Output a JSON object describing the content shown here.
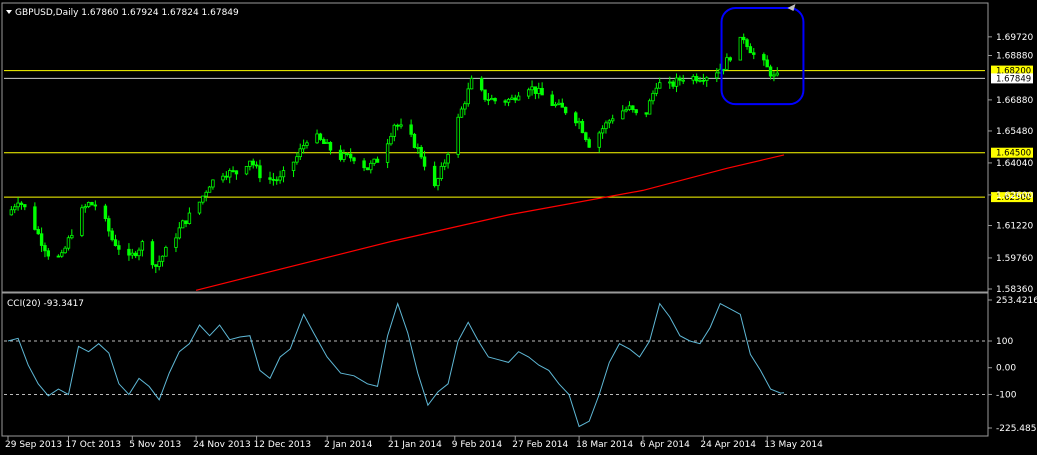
{
  "chart_data": [
    {
      "type": "candlestick",
      "title": "GBPUSD,Daily  1.67860 1.67924 1.67824 1.67849",
      "symbol": "GBPUSD",
      "timeframe": "Daily",
      "ohlc_readout": {
        "open": "1.67860",
        "high": "1.67924",
        "low": "1.67824",
        "close": "1.67849"
      },
      "ylim": [
        1.5836,
        1.712
      ],
      "y_ticks": [
        "1.69720",
        "1.68880",
        "1.66880",
        "1.65480",
        "1.64040",
        "1.62600",
        "1.61220",
        "1.59760",
        "1.58360"
      ],
      "x_ticks": [
        "29 Sep 2013",
        "17 Oct 2013",
        "5 Nov 2013",
        "24 Nov 2013",
        "12 Dec 2013",
        "2 Jan 2014",
        "21 Jan 2014",
        "9 Feb 2014",
        "27 Feb 2014",
        "18 Mar 2014",
        "6 Apr 2014",
        "24 Apr 2014",
        "13 May 2014"
      ],
      "x_start": "2013-09-29",
      "x_end": "2014-05-18",
      "candle_color": "#00ff00",
      "horizontal_levels": [
        {
          "value": 1.682,
          "label": "1.68200",
          "color": "#ffff00"
        },
        {
          "value": 1.645,
          "label": "1.64500",
          "color": "#ffff00"
        },
        {
          "value": 1.625,
          "label": "1.62500",
          "color": "#ffff00"
        }
      ],
      "current_price": {
        "value": 1.67849,
        "label": "1.67849",
        "color": "#ffffff"
      },
      "moving_average": {
        "color": "#ff0000",
        "points": [
          {
            "x": "2013-11-24",
            "y": 1.583
          },
          {
            "x": "2014-01-21",
            "y": 1.605
          },
          {
            "x": "2014-02-25",
            "y": 1.617
          },
          {
            "x": "2014-04-06",
            "y": 1.628
          },
          {
            "x": "2014-05-01",
            "y": 1.638
          },
          {
            "x": "2014-05-18",
            "y": 1.644
          }
        ]
      },
      "close_path": [
        {
          "x": "2013-09-29",
          "y": 1.617
        },
        {
          "x": "2013-10-02",
          "y": 1.624
        },
        {
          "x": "2013-10-05",
          "y": 1.618
        },
        {
          "x": "2013-10-09",
          "y": 1.605
        },
        {
          "x": "2013-10-12",
          "y": 1.597
        },
        {
          "x": "2013-10-15",
          "y": 1.598
        },
        {
          "x": "2013-10-20",
          "y": 1.617
        },
        {
          "x": "2013-10-23",
          "y": 1.622
        },
        {
          "x": "2013-10-26",
          "y": 1.621
        },
        {
          "x": "2013-10-30",
          "y": 1.606
        },
        {
          "x": "2013-11-04",
          "y": 1.597
        },
        {
          "x": "2013-11-08",
          "y": 1.604
        },
        {
          "x": "2013-11-12",
          "y": 1.594
        },
        {
          "x": "2013-11-16",
          "y": 1.603
        },
        {
          "x": "2013-11-20",
          "y": 1.613
        },
        {
          "x": "2013-11-24",
          "y": 1.62
        },
        {
          "x": "2013-11-28",
          "y": 1.631
        },
        {
          "x": "2013-12-02",
          "y": 1.636
        },
        {
          "x": "2013-12-06",
          "y": 1.636
        },
        {
          "x": "2013-12-10",
          "y": 1.642
        },
        {
          "x": "2013-12-14",
          "y": 1.633
        },
        {
          "x": "2013-12-19",
          "y": 1.633
        },
        {
          "x": "2013-12-24",
          "y": 1.643
        },
        {
          "x": "2013-12-28",
          "y": 1.654
        },
        {
          "x": "2014-01-01",
          "y": 1.649
        },
        {
          "x": "2014-01-06",
          "y": 1.643
        },
        {
          "x": "2014-01-10",
          "y": 1.643
        },
        {
          "x": "2014-01-14",
          "y": 1.638
        },
        {
          "x": "2014-01-18",
          "y": 1.643
        },
        {
          "x": "2014-01-22",
          "y": 1.658
        },
        {
          "x": "2014-01-26",
          "y": 1.654
        },
        {
          "x": "2014-01-30",
          "y": 1.644
        },
        {
          "x": "2014-02-03",
          "y": 1.629
        },
        {
          "x": "2014-02-06",
          "y": 1.641
        },
        {
          "x": "2014-02-10",
          "y": 1.66
        },
        {
          "x": "2014-02-14",
          "y": 1.677
        },
        {
          "x": "2014-02-18",
          "y": 1.67
        },
        {
          "x": "2014-02-22",
          "y": 1.668
        },
        {
          "x": "2014-02-26",
          "y": 1.669
        },
        {
          "x": "2014-03-02",
          "y": 1.676
        },
        {
          "x": "2014-03-06",
          "y": 1.672
        },
        {
          "x": "2014-03-10",
          "y": 1.667
        },
        {
          "x": "2014-03-14",
          "y": 1.664
        },
        {
          "x": "2014-03-18",
          "y": 1.659
        },
        {
          "x": "2014-03-21",
          "y": 1.649
        },
        {
          "x": "2014-03-25",
          "y": 1.656
        },
        {
          "x": "2014-03-29",
          "y": 1.663
        },
        {
          "x": "2014-04-02",
          "y": 1.665
        },
        {
          "x": "2014-04-06",
          "y": 1.659
        },
        {
          "x": "2014-04-10",
          "y": 1.676
        },
        {
          "x": "2014-04-14",
          "y": 1.675
        },
        {
          "x": "2014-04-18",
          "y": 1.679
        },
        {
          "x": "2014-04-22",
          "y": 1.679
        },
        {
          "x": "2014-04-26",
          "y": 1.68
        },
        {
          "x": "2014-04-30",
          "y": 1.684
        },
        {
          "x": "2014-05-03",
          "y": 1.691
        },
        {
          "x": "2014-05-06",
          "y": 1.697
        },
        {
          "x": "2014-05-09",
          "y": 1.689
        },
        {
          "x": "2014-05-12",
          "y": 1.685
        },
        {
          "x": "2014-05-15",
          "y": 1.679
        },
        {
          "x": "2014-05-18",
          "y": 1.679
        }
      ],
      "annotation": {
        "shape": "rounded-rectangle",
        "color": "#0000ff",
        "x_range": [
          "2014-04-30",
          "2014-05-22"
        ],
        "y_range": [
          1.675,
          1.712
        ]
      }
    },
    {
      "type": "line",
      "title": "CCI(20) -93.3417",
      "indicator": "CCI(20)",
      "current_value": "-93.3417",
      "ylim": [
        -225.4853,
        253.4216
      ],
      "y_ticks": [
        "253.4216",
        "100",
        "0.00",
        "-100",
        "-225.4853"
      ],
      "reference_lines": [
        100,
        -100
      ],
      "line_color": "#5fb8d6",
      "series": [
        {
          "values": [
            {
              "x": "2013-09-29",
              "y": 100
            },
            {
              "x": "2013-10-02",
              "y": 110
            },
            {
              "x": "2013-10-05",
              "y": 10
            },
            {
              "x": "2013-10-08",
              "y": -60
            },
            {
              "x": "2013-10-11",
              "y": -105
            },
            {
              "x": "2013-10-14",
              "y": -80
            },
            {
              "x": "2013-10-17",
              "y": -100
            },
            {
              "x": "2013-10-20",
              "y": 80
            },
            {
              "x": "2013-10-23",
              "y": 60
            },
            {
              "x": "2013-10-26",
              "y": 90
            },
            {
              "x": "2013-10-29",
              "y": 55
            },
            {
              "x": "2013-11-01",
              "y": -60
            },
            {
              "x": "2013-11-04",
              "y": -100
            },
            {
              "x": "2013-11-07",
              "y": -40
            },
            {
              "x": "2013-11-10",
              "y": -70
            },
            {
              "x": "2013-11-13",
              "y": -120
            },
            {
              "x": "2013-11-16",
              "y": -20
            },
            {
              "x": "2013-11-19",
              "y": 60
            },
            {
              "x": "2013-11-22",
              "y": 90
            },
            {
              "x": "2013-11-25",
              "y": 160
            },
            {
              "x": "2013-11-28",
              "y": 120
            },
            {
              "x": "2013-12-01",
              "y": 160
            },
            {
              "x": "2013-12-04",
              "y": 105
            },
            {
              "x": "2013-12-07",
              "y": 115
            },
            {
              "x": "2013-12-10",
              "y": 120
            },
            {
              "x": "2013-12-13",
              "y": -10
            },
            {
              "x": "2013-12-16",
              "y": -40
            },
            {
              "x": "2013-12-19",
              "y": 40
            },
            {
              "x": "2013-12-22",
              "y": 70
            },
            {
              "x": "2013-12-26",
              "y": 200
            },
            {
              "x": "2013-12-29",
              "y": 130
            },
            {
              "x": "2014-01-02",
              "y": 40
            },
            {
              "x": "2014-01-06",
              "y": -20
            },
            {
              "x": "2014-01-10",
              "y": -30
            },
            {
              "x": "2014-01-14",
              "y": -60
            },
            {
              "x": "2014-01-17",
              "y": -70
            },
            {
              "x": "2014-01-20",
              "y": 120
            },
            {
              "x": "2014-01-23",
              "y": 240
            },
            {
              "x": "2014-01-26",
              "y": 130
            },
            {
              "x": "2014-01-29",
              "y": -20
            },
            {
              "x": "2014-02-01",
              "y": -140
            },
            {
              "x": "2014-02-04",
              "y": -90
            },
            {
              "x": "2014-02-07",
              "y": -60
            },
            {
              "x": "2014-02-10",
              "y": 100
            },
            {
              "x": "2014-02-13",
              "y": 170
            },
            {
              "x": "2014-02-16",
              "y": 100
            },
            {
              "x": "2014-02-19",
              "y": 40
            },
            {
              "x": "2014-02-22",
              "y": 30
            },
            {
              "x": "2014-02-25",
              "y": 20
            },
            {
              "x": "2014-02-28",
              "y": 60
            },
            {
              "x": "2014-03-03",
              "y": 40
            },
            {
              "x": "2014-03-06",
              "y": 10
            },
            {
              "x": "2014-03-09",
              "y": -10
            },
            {
              "x": "2014-03-12",
              "y": -60
            },
            {
              "x": "2014-03-15",
              "y": -100
            },
            {
              "x": "2014-03-18",
              "y": -220
            },
            {
              "x": "2014-03-21",
              "y": -200
            },
            {
              "x": "2014-03-24",
              "y": -100
            },
            {
              "x": "2014-03-27",
              "y": 20
            },
            {
              "x": "2014-03-30",
              "y": 90
            },
            {
              "x": "2014-04-02",
              "y": 70
            },
            {
              "x": "2014-04-05",
              "y": 40
            },
            {
              "x": "2014-04-08",
              "y": 100
            },
            {
              "x": "2014-04-11",
              "y": 240
            },
            {
              "x": "2014-04-14",
              "y": 190
            },
            {
              "x": "2014-04-17",
              "y": 120
            },
            {
              "x": "2014-04-20",
              "y": 100
            },
            {
              "x": "2014-04-23",
              "y": 90
            },
            {
              "x": "2014-04-26",
              "y": 150
            },
            {
              "x": "2014-04-29",
              "y": 240
            },
            {
              "x": "2014-05-02",
              "y": 220
            },
            {
              "x": "2014-05-05",
              "y": 200
            },
            {
              "x": "2014-05-08",
              "y": 50
            },
            {
              "x": "2014-05-11",
              "y": -10
            },
            {
              "x": "2014-05-14",
              "y": -80
            },
            {
              "x": "2014-05-17",
              "y": -95
            },
            {
              "x": "2014-05-18",
              "y": -93.3
            }
          ]
        }
      ]
    }
  ]
}
